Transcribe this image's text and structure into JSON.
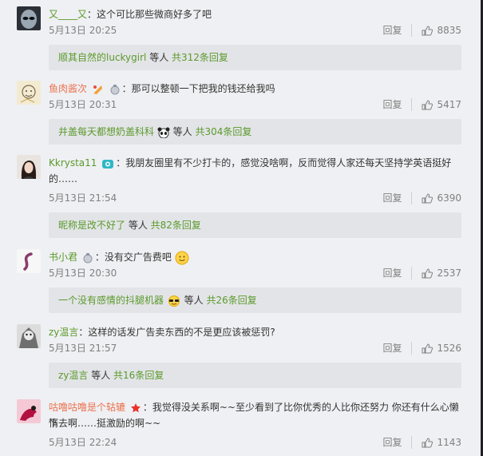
{
  "comments": [
    {
      "user": "又____又",
      "text": "：这个可比那些微商好多了吧",
      "time": "5月13日 20:25",
      "reply": "回复",
      "likes": "8835",
      "sub": {
        "user": "顺其自然的luckygirl",
        "mid": " 等人 ",
        "total": "共312条回复"
      }
    },
    {
      "user": "鱼肉酱次",
      "text": "：那可以整顿一下把我的钱还给我吗",
      "time": "5月13日 20:31",
      "reply": "回复",
      "likes": "5417",
      "sub": {
        "user": "井盖每天都想奶盖科科",
        "mid": " 等人 ",
        "total": "共304条回复"
      }
    },
    {
      "user": "Kkrysta11",
      "text": "：我朋友圈里有不少打卡的，感觉没啥啊，反而觉得人家还每天坚持学英语挺好",
      "text2": "的……",
      "time": "5月13日 21:54",
      "reply": "回复",
      "likes": "6390",
      "sub": {
        "user": "昵称是改不好了",
        "mid": " 等人 ",
        "total": "共82条回复"
      }
    },
    {
      "user": "书小君",
      "text": "：没有交广告费吧",
      "time": "5月13日 20:30",
      "reply": "回复",
      "likes": "2537",
      "sub": {
        "user": "一个没有感情的抖腿机器",
        "mid": " 等人 ",
        "total": "共26条回复"
      }
    },
    {
      "user": "zy温言",
      "text": "：这样的话发广告卖东西的不是更应该被惩罚?",
      "time": "5月13日 21:57",
      "reply": "回复",
      "likes": "1526",
      "sub": {
        "user": "zy温言",
        "mid": " 等人 ",
        "total": "共16条回复"
      }
    },
    {
      "user": "咕噜咕噜是个轱辘",
      "text": "：我觉得没关系啊~~至少看到了比你优秀的人比你还努力 你还有什么心懒惰",
      "text2": "下去啊……挺激励的啊~~",
      "time": "5月13日 22:24",
      "reply": "回复",
      "likes": "1143"
    }
  ],
  "colors": {
    "username": "#eb7350",
    "link": "#5b9a2b",
    "meta": "#808080",
    "panel": "#e3e4e8"
  }
}
